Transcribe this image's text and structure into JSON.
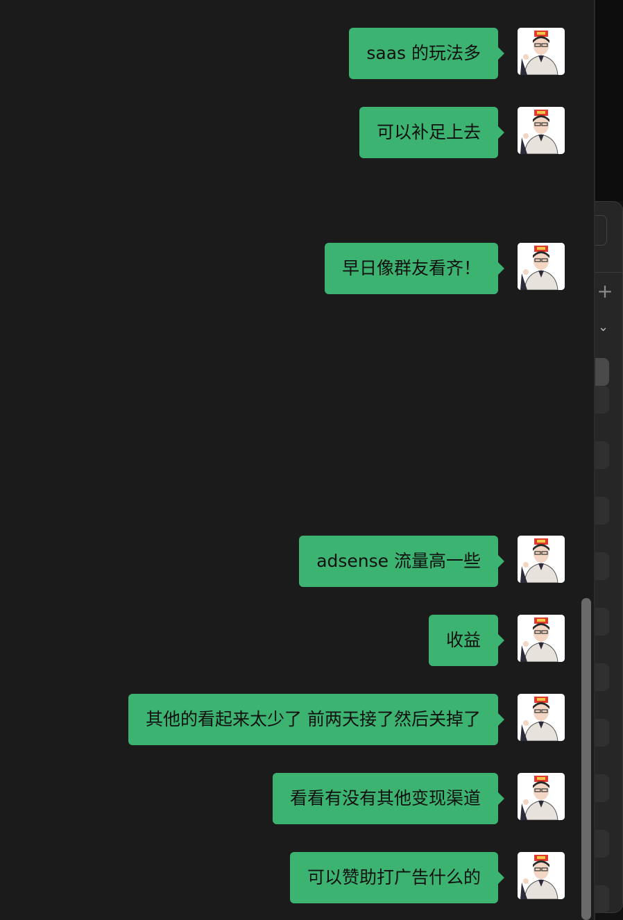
{
  "colors": {
    "background": "#1b1b1b",
    "bubble": "#3cb371",
    "bubble_text": "#101010"
  },
  "messages": [
    {
      "text": "saas 的玩法多",
      "sender": "self"
    },
    {
      "text": "可以补足上去",
      "sender": "self"
    },
    {
      "text": "早日像群友看齐！",
      "sender": "self"
    },
    {
      "text": "adsense 流量高一些",
      "sender": "self"
    },
    {
      "text": "收益",
      "sender": "self"
    },
    {
      "text": "其他的看起来太少了 前两天接了然后关掉了",
      "sender": "self"
    },
    {
      "text": "看看有没有其他变现渠道",
      "sender": "self"
    },
    {
      "text": "可以赞助打广告什么的",
      "sender": "self"
    }
  ],
  "side_panel": {
    "icons": [
      "plus-icon",
      "chevron-down-icon"
    ]
  }
}
